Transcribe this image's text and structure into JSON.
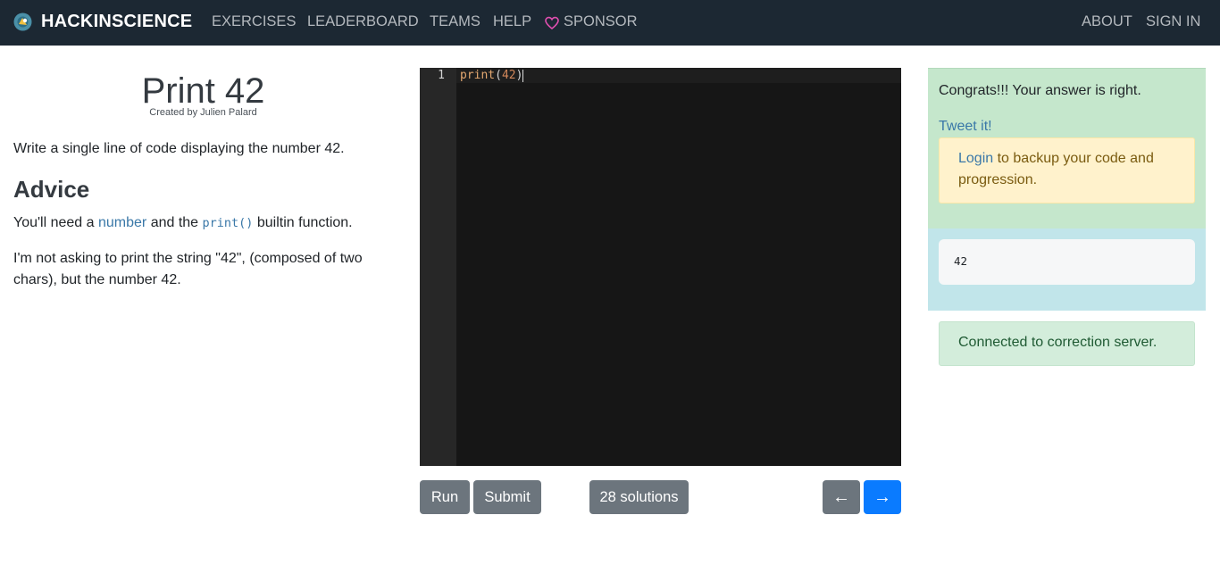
{
  "nav": {
    "brand": "HACKINSCIENCE",
    "links": [
      "EXERCISES",
      "LEADERBOARD",
      "TEAMS",
      "HELP"
    ],
    "sponsor": "SPONSOR",
    "right": [
      "ABOUT",
      "SIGN IN"
    ]
  },
  "exercise": {
    "title": "Print 42",
    "author": "Created by Julien Palard",
    "description": "Write a single line of code displaying the number 42.",
    "advice_heading": "Advice",
    "advice_p1": {
      "before": "You'll need a ",
      "link": "number",
      "middle": " and the ",
      "code": "print()",
      "after": " builtin function."
    },
    "advice_p2": "I'm not asking to print the string \"42\", (composed of two chars), but the number 42."
  },
  "editor": {
    "line_number": "1",
    "tokens": {
      "fn": "print",
      "open": "(",
      "num": "42",
      "close": ")"
    }
  },
  "buttons": {
    "run": "Run",
    "submit": "Submit",
    "solutions": "28 solutions",
    "prev": "←",
    "next": "→"
  },
  "result": {
    "congrats": "Congrats!!! Your answer is right.",
    "tweet": "Tweet it!",
    "login_link": "Login",
    "login_rest": " to backup your code and progression.",
    "output": "42",
    "connection": "Connected to correction server."
  },
  "colors": {
    "navbar": "#1c2833",
    "success_bg": "#c5e7cc",
    "warning_bg": "#fff2cc",
    "output_bg": "#c1e5ea",
    "primary": "#0a7bff",
    "secondary": "#6c757d"
  }
}
